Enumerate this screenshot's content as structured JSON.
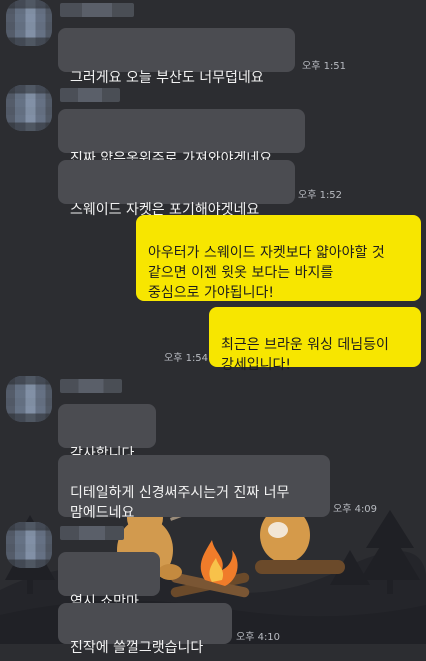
{
  "colors": {
    "background": "#2c2d31",
    "incoming_bubble": "#4b4c51",
    "outgoing_bubble": "#f7e600",
    "timestamp": "#b9bcc2"
  },
  "messages": [
    {
      "text": "그러게요 오늘 부산도 너무덥네요",
      "time": "오후 1:51"
    },
    {
      "text": "진짜 얇은옷위주로 가져와야겟네요",
      "time": ""
    },
    {
      "text": "스웨이드 자켓은 포기해야겟네요",
      "time": "오후 1:52"
    },
    {
      "text": "아우터가 스웨이드 자켓보다 얇아야할 것\n같으면 이젠 윗옷 보다는 바지를\n중심으로 가야됩니다!",
      "time": ""
    },
    {
      "text": "최근은 브라운 워싱 데님등이\n강세입니다!",
      "time": "오후 1:54"
    },
    {
      "text": "감사합니다",
      "time": ""
    },
    {
      "text": "디테일하게 신경써주시는거 진짜 너무\n맘에드네요",
      "time": "오후 4:09"
    },
    {
      "text": "역시 쇼만마",
      "time": ""
    },
    {
      "text": "진작에 쓸껄그랫습니다",
      "time": "오후 4:10"
    }
  ]
}
